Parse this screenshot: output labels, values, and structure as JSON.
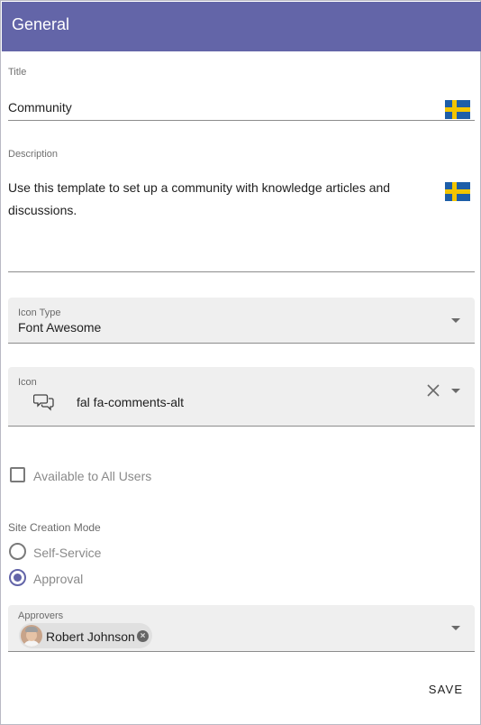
{
  "header": {
    "title": "General"
  },
  "title_field": {
    "label": "Title",
    "value": "Community",
    "flag_icon": "sweden-flag-icon"
  },
  "description_field": {
    "label": "Description",
    "line1": "Use this template to set up a community with knowledge articles and",
    "line2": "discussions.",
    "flag_icon": "sweden-flag-icon"
  },
  "icon_type": {
    "label": "Icon Type",
    "value": "Font Awesome",
    "icon": "chevron-down-icon"
  },
  "icon_field": {
    "label": "Icon",
    "value": "fal fa-comments-alt",
    "preview_icon": "comments-icon",
    "clear_icon": "close-icon"
  },
  "available_all_users": {
    "label": "Available to All Users",
    "checked": false
  },
  "site_creation_mode": {
    "label": "Site Creation Mode",
    "options": [
      {
        "label": "Self-Service",
        "selected": false
      },
      {
        "label": "Approval",
        "selected": true
      }
    ]
  },
  "approvers": {
    "label": "Approvers",
    "chip_name": "Robert Johnson",
    "chip_remove": "×"
  },
  "actions": {
    "save_label": "SAVE"
  },
  "colors": {
    "accent": "#6365a8",
    "field_bg": "#efefef",
    "chip_bg": "#e0e0e0",
    "flag_blue": "#1d5ea8",
    "flag_yellow": "#f2c500"
  }
}
